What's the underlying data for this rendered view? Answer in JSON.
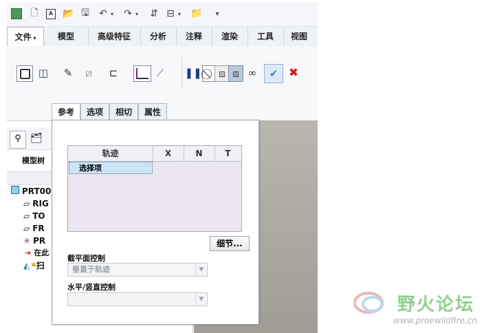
{
  "menu": {
    "items": [
      "文件",
      "模型",
      "高级特征",
      "分析",
      "注释",
      "渲染",
      "工具",
      "视图"
    ]
  },
  "dashboard": {
    "tabs": [
      "参考",
      "选项",
      "相切",
      "属性"
    ]
  },
  "left_panel": {
    "tree_label": "模型树",
    "items": [
      "PRT00",
      "RIG",
      "TO",
      "FR",
      "PR",
      "在此",
      "扫"
    ]
  },
  "reference_panel": {
    "table": {
      "headers": [
        "轨迹",
        "X",
        "N",
        "T"
      ],
      "selected_cell": "选择项"
    },
    "detail_button": "细节...",
    "section_plane_control": {
      "label": "截平面控制",
      "value": "垂直于轨迹"
    },
    "horiz_vert_control": {
      "label": "水平/竖直控制",
      "value": ""
    }
  },
  "watermark": {
    "text": "野火论坛",
    "url": "www.proewildfire.cn"
  },
  "colors": {
    "confirm": "#3a7fc8",
    "cancel": "#d21a1a",
    "selection": "#cce4f7"
  }
}
